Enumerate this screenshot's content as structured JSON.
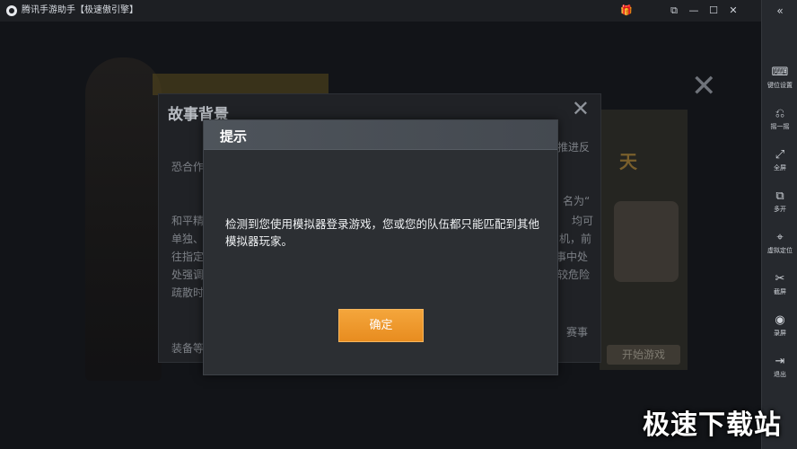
{
  "window": {
    "title": "腾讯手游助手【极速傲引擎】",
    "controls": {
      "gift": "🎁",
      "restore": "⧉",
      "minimize": "—",
      "maximize": "☐",
      "close": "✕"
    }
  },
  "background": {
    "panel_title": "故事背景",
    "panel_close": "✕",
    "big_close": "✕",
    "lines": [
      "恐合作",
      "和平精",
      "单独、",
      "往指定",
      "处强调",
      "疏散时",
      "装备等"
    ],
    "right_lines": [
      "推进反",
      "名为“",
      "均可",
      "机，前",
      "赛事中处",
      "较危险",
      "赛事"
    ],
    "side_badge": "天",
    "side_button": "开始游戏"
  },
  "dialog": {
    "title": "提示",
    "message": "检测到您使用模拟器登录游戏，您或您的队伍都只能匹配到其他模拟器玩家。",
    "confirm": "确定"
  },
  "sidebar": {
    "collapse": "«",
    "items": [
      {
        "icon": "⌨",
        "label": "键位设置"
      },
      {
        "icon": "⎌",
        "label": "摇一摇"
      },
      {
        "icon": "⤢",
        "label": "全屏"
      },
      {
        "icon": "⧉",
        "label": "多开"
      },
      {
        "icon": "⌖",
        "label": "虚拟定位"
      },
      {
        "icon": "✂",
        "label": "截屏"
      },
      {
        "icon": "◉",
        "label": "录屏"
      },
      {
        "icon": "⇥",
        "label": "退出"
      }
    ]
  },
  "watermark": "极速下载站"
}
